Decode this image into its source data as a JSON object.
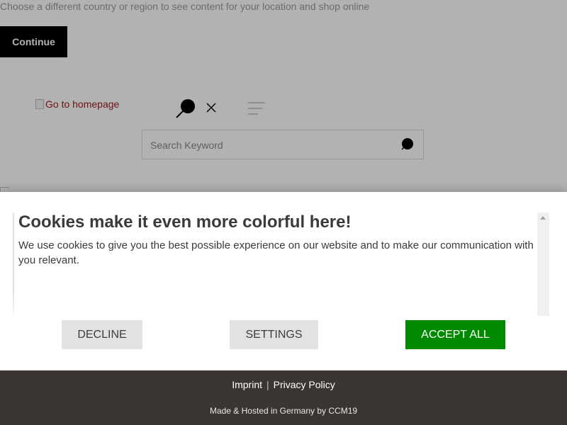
{
  "page": {
    "country_note": "Choose a different country or region to see content for your location and shop online",
    "continue_label": "Continue",
    "logo_alt": "Go to homepage",
    "search": {
      "placeholder": "Search Keyword",
      "search_icon": "search-icon",
      "close_icon": "close-icon",
      "menu_icon": "menu-icon"
    }
  },
  "cookie_banner": {
    "title": "Cookies make it even more colorful here!",
    "description": "We use cookies to give you the best possible experience on our website and to make our communication with you relevant.",
    "decline_label": "Decline",
    "settings_label": "Settings",
    "accept_label": "Accept all",
    "accept_color": "#008a00",
    "secondary_button_color": "#e2e2e2"
  },
  "footer": {
    "imprint_label": "Imprint",
    "separator": "|",
    "privacy_label": "Privacy Policy",
    "credit": "Made & Hosted in Germany by CCM19",
    "background_color": "#3b3633"
  }
}
